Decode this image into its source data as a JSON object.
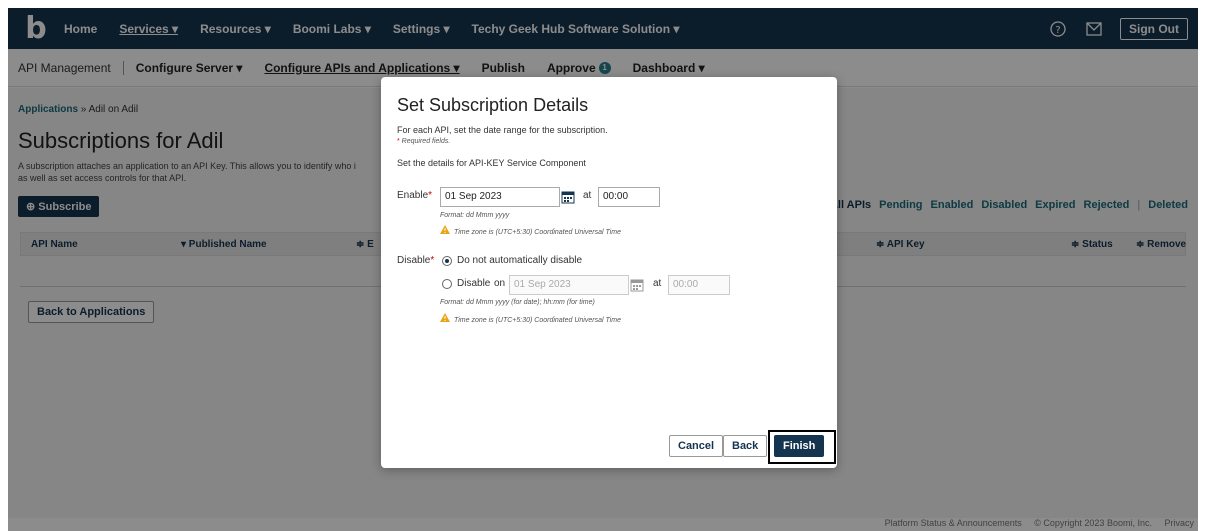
{
  "topnav": {
    "logo": "b",
    "items": [
      "Home",
      "Services ▾",
      "Resources ▾",
      "Boomi Labs ▾",
      "Settings ▾",
      "Techy Geek Hub Software Solution ▾"
    ],
    "signout": "Sign Out"
  },
  "subnav": {
    "title": "API Management",
    "items": [
      "Configure Server ▾",
      "Configure APIs and Applications ▾",
      "Publish",
      "Approve",
      "Dashboard ▾"
    ],
    "approve_badge": "1"
  },
  "page": {
    "breadcrumb_link": "Applications",
    "breadcrumb_rest": " » Adil on Adil",
    "title": "Subscriptions for Adil",
    "desc_1": "A subscription attaches an application to an API Key. This allows you to identify who i",
    "desc_2": "as well as set access controls for that API.",
    "subscribe": "Subscribe",
    "filters": [
      "All APIs",
      "Pending",
      "Enabled",
      "Disabled",
      "Expired",
      "Rejected",
      "|",
      "Deleted"
    ],
    "columns": [
      "API Name",
      "▾  Published Name",
      "≑  E",
      "≑  API Key",
      "≑  Status",
      "≑  Remove"
    ],
    "back": "Back to Applications"
  },
  "footer": [
    "Platform Status & Announcements",
    "© Copyright 2023 Boomi, Inc.",
    "Privacy"
  ],
  "modal": {
    "title": "Set Subscription Details",
    "instruction": "For each API, set the date range for the subscription.",
    "required_star": "*",
    "required": " Required fields.",
    "details": "Set the details for API-KEY Service Component",
    "enable_label": "Enable",
    "enable_date": "01 Sep 2023",
    "at": "at",
    "enable_time": "00:00",
    "format_1": "Format: dd Mmm yyyy",
    "timezone": "Time zone is (UTC+5:30) Coordinated Universal Time",
    "disable_label": "Disable",
    "opt_no": "Do not automatically disable",
    "opt_disable": "Disable",
    "on": "on",
    "disable_date": "01 Sep 2023",
    "disable_time": "00:00",
    "format_2": "Format: dd Mmm yyyy (for date); hh:mm (for time)",
    "cancel": "Cancel",
    "back": "Back",
    "finish": "Finish"
  }
}
